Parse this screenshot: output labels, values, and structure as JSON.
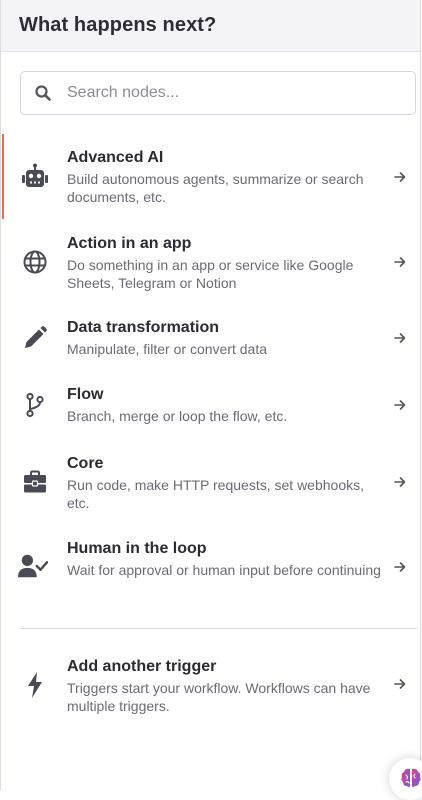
{
  "header": {
    "title": "What happens next?"
  },
  "search": {
    "placeholder": "Search nodes..."
  },
  "items": [
    {
      "title": "Advanced AI",
      "desc": "Build autonomous agents, summarize or search documents, etc.",
      "icon": "robot-icon"
    },
    {
      "title": "Action in an app",
      "desc": "Do something in an app or service like Google Sheets, Telegram or Notion",
      "icon": "globe-icon"
    },
    {
      "title": "Data transformation",
      "desc": "Manipulate, filter or convert data",
      "icon": "pen-icon"
    },
    {
      "title": "Flow",
      "desc": "Branch, merge or loop the flow, etc.",
      "icon": "branch-icon"
    },
    {
      "title": "Core",
      "desc": "Run code, make HTTP requests, set webhooks, etc.",
      "icon": "toolbox-icon"
    },
    {
      "title": "Human in the loop",
      "desc": "Wait for approval or human input before continuing",
      "icon": "user-check-icon"
    }
  ],
  "trigger": {
    "title": "Add another trigger",
    "desc": "Triggers start your workflow. Workflows can have multiple triggers.",
    "icon": "bolt-icon"
  },
  "colors": {
    "accent": "#ea6b4f",
    "icon": "#4a4a55",
    "header_bg": "#f4f4f8"
  }
}
